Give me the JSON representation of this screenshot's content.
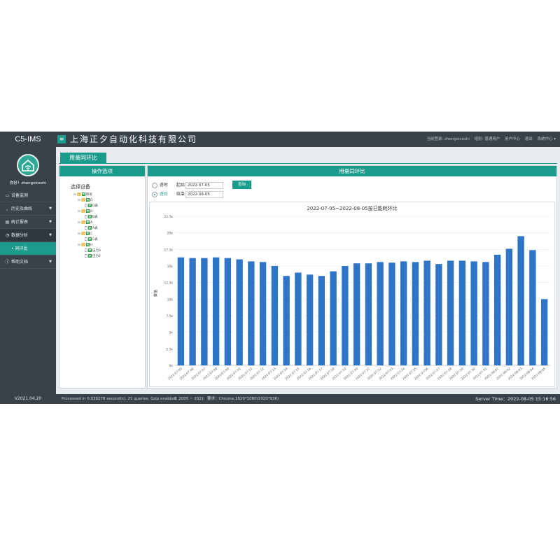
{
  "app": {
    "brand": "C5-IMS",
    "company": "上海正夕自动化科技有限公司",
    "menu_icon": "≡",
    "version": "V2021.04.20"
  },
  "header": {
    "login": "当前登录: zhengxiceshi",
    "group": "组别: 普通用户",
    "center": "用户中心",
    "exit": "退出",
    "more": "系统中心 ▾"
  },
  "user": {
    "label": "你好！zhengxiceshi"
  },
  "nav": {
    "items": [
      {
        "label": "设备监测",
        "icon": "monitor-icon",
        "arrow": ""
      },
      {
        "label": "历史及曲线",
        "icon": "chart-icon",
        "arrow": "▼"
      },
      {
        "label": "统计报表",
        "icon": "report-icon",
        "arrow": "▼"
      },
      {
        "label": "数据分析",
        "icon": "analysis-icon",
        "arrow": "▼"
      },
      {
        "label": "• 同环比",
        "icon": "",
        "arrow": ""
      },
      {
        "label": "帮助文档",
        "icon": "help-icon",
        "arrow": "▼"
      }
    ]
  },
  "tab": {
    "label": "用量同环比"
  },
  "left_panel": {
    "title": "操作选项",
    "tree_title": "选择设备",
    "tree": [
      "所有",
      "D",
      "D表",
      "B",
      "B表",
      "A",
      "A表",
      "C",
      "C表",
      "H",
      "压力3",
      "压力2"
    ]
  },
  "right_panel": {
    "title": "用量同环比",
    "radio_hour": "逐时",
    "radio_day": "逐日",
    "start_label": "起始",
    "start_value": "2022-07-05",
    "end_label": "结束",
    "end_value": "2022-08-05",
    "query_button": "查询"
  },
  "chart_data": {
    "type": "bar",
    "title": "2022-07-05~2022-08-05按日能耗环比",
    "ylabel": "数值",
    "ylim": [
      0,
      22500
    ],
    "yticks": [
      "0k",
      "2.5k",
      "5k",
      "7.5k",
      "10k",
      "12.5k",
      "15k",
      "17.5k",
      "20k",
      "22.5k"
    ],
    "color": "#2e75c7",
    "categories": [
      "2022-07-05",
      "2022-07-06",
      "2022-07-07",
      "2022-07-08",
      "2022-07-09",
      "2022-07-10",
      "2022-07-11",
      "2022-07-12",
      "2022-07-13",
      "2022-07-14",
      "2022-07-15",
      "2022-07-16",
      "2022-07-17",
      "2022-07-18",
      "2022-07-19",
      "2022-07-20",
      "2022-07-21",
      "2022-07-22",
      "2022-07-23",
      "2022-07-24",
      "2022-07-25",
      "2022-07-26",
      "2022-07-27",
      "2022-07-28",
      "2022-07-29",
      "2022-07-30",
      "2022-07-31",
      "2022-08-01",
      "2022-08-02",
      "2022-08-03",
      "2022-08-04",
      "2022-08-05"
    ],
    "values": [
      16300,
      16200,
      16200,
      16300,
      16200,
      16000,
      15700,
      15600,
      15000,
      13500,
      14000,
      13700,
      13500,
      14200,
      15000,
      15400,
      15400,
      15600,
      15500,
      15700,
      15600,
      15800,
      15300,
      15800,
      15800,
      15700,
      15600,
      16700,
      17600,
      19500,
      17400,
      10000
    ]
  },
  "footer": {
    "processed": "Processed in 0.039278 second(s), 21 queries, Gzip enabled.",
    "copyright": "© 2005 ~ 2021",
    "env": "要求：Chrome,1920*1080(1920*936)",
    "server_time": "Server Time：2022-08-05 15:16:56"
  }
}
